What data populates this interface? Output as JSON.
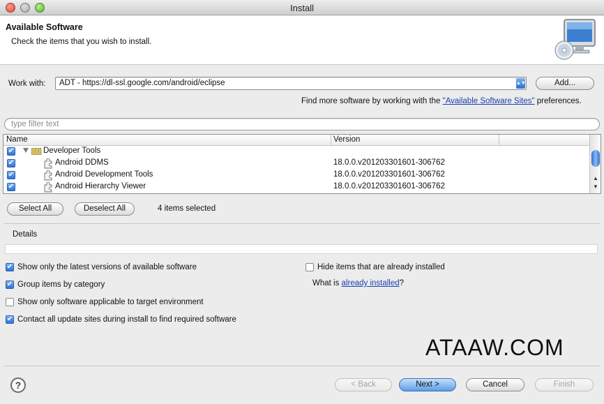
{
  "window": {
    "title": "Install"
  },
  "banner": {
    "title": "Available Software",
    "description": "Check the items that you wish to install."
  },
  "work_with": {
    "label": "Work with:",
    "value": "ADT - https://dl-ssl.google.com/android/eclipse",
    "add_button": "Add..."
  },
  "find_more": {
    "prefix": "Find more software by working with the ",
    "link": "\"Available Software Sites\"",
    "suffix": " preferences."
  },
  "filter": {
    "placeholder": "type filter text"
  },
  "tree": {
    "columns": [
      "Name",
      "Version"
    ],
    "category": {
      "name": "Developer Tools",
      "checked": true
    },
    "items": [
      {
        "name": "Android DDMS",
        "version": "18.0.0.v201203301601-306762",
        "checked": true
      },
      {
        "name": "Android Development Tools",
        "version": "18.0.0.v201203301601-306762",
        "checked": true
      },
      {
        "name": "Android Hierarchy Viewer",
        "version": "18.0.0.v201203301601-306762",
        "checked": true
      }
    ]
  },
  "selection": {
    "select_all": "Select All",
    "deselect_all": "Deselect All",
    "status": "4 items selected"
  },
  "details": {
    "label": "Details"
  },
  "options": {
    "latest_versions": {
      "label": "Show only the latest versions of available software",
      "checked": true
    },
    "group_by_category": {
      "label": "Group items by category",
      "checked": true
    },
    "applicable_only": {
      "label": "Show only software applicable to target environment",
      "checked": false
    },
    "contact_sites": {
      "label": "Contact all update sites during install to find required software",
      "checked": true
    },
    "hide_installed": {
      "label": "Hide items that are already installed",
      "checked": false
    }
  },
  "what_is": {
    "prefix": "What is ",
    "link": "already installed",
    "suffix": "?"
  },
  "watermark": "ATAAW.COM",
  "footer": {
    "back": "< Back",
    "next": "Next >",
    "cancel": "Cancel",
    "finish": "Finish"
  },
  "icons": {
    "checkmark": "✔",
    "help": "?",
    "scroll_up": "▲",
    "scroll_down": "▼",
    "combo_arrow": "▲▼"
  }
}
